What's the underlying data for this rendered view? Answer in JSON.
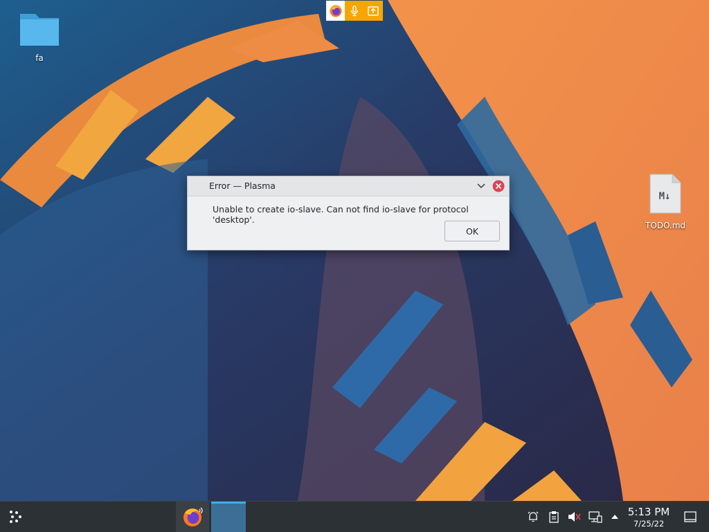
{
  "desktop": {
    "icons": [
      {
        "label": "fa",
        "type": "folder"
      },
      {
        "label": "TODO.md",
        "type": "markdown-file"
      }
    ]
  },
  "share_indicator": {
    "items": [
      "firefox-icon",
      "microphone-icon",
      "screen-share-icon"
    ],
    "color": "#f7a600"
  },
  "dialog": {
    "title": "Error — Plasma",
    "message": "Unable to create io-slave. Can not find io-slave for protocol 'desktop'.",
    "ok_label": "OK"
  },
  "file_icon_text": "M↓",
  "taskbar": {
    "launcher_icon": "kde-launcher-icon",
    "tasks": [
      "firefox-task",
      "active-window-task"
    ],
    "tray_icons": [
      "notifications-icon",
      "clipboard-icon",
      "volume-muted-icon",
      "network-icon",
      "tray-expand-icon"
    ],
    "clock": {
      "time": "5:13 PM",
      "date": "7/25/22"
    }
  }
}
